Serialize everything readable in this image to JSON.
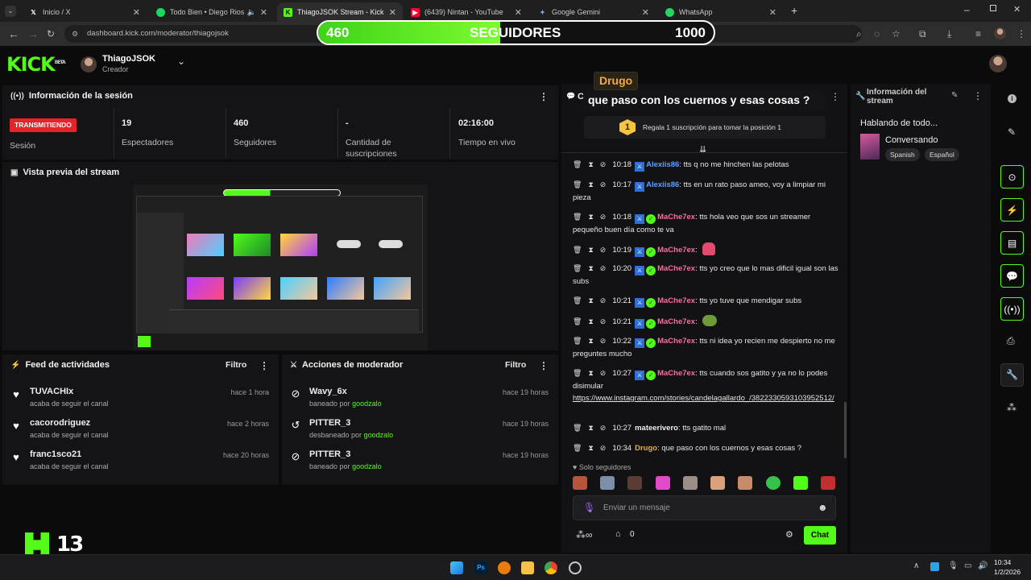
{
  "browser": {
    "tabs": [
      {
        "title": "Inicio / X",
        "icon": "x-logo-icon"
      },
      {
        "title": "Todo Bien • Diego Rios",
        "icon": "spotify-icon"
      },
      {
        "title": "ThiagoJSOK Stream - Kick Dash",
        "icon": "kick-icon"
      },
      {
        "title": "(6439) Nintan - YouTube",
        "icon": "youtube-icon"
      },
      {
        "title": "Google Gemini",
        "icon": "gemini-icon"
      },
      {
        "title": "WhatsApp",
        "icon": "whatsapp-icon"
      }
    ],
    "url": "dashboard.kick.com/moderator/thiagojsok"
  },
  "goal": {
    "current": "460",
    "title": "SEGUIDORES",
    "max": "1000",
    "progress": 0.46
  },
  "header": {
    "logo": "KICK",
    "logo_sup": "BETA",
    "channel": "ThiagoJSOK",
    "role": "Creador"
  },
  "session": {
    "title": "Información de la sesión",
    "live_badge": "TRANSMITIENDO",
    "label": "Sesión",
    "stats": [
      {
        "value": "19",
        "label": "Espectadores"
      },
      {
        "value": "460",
        "label": "Seguidores"
      },
      {
        "value": "-",
        "label": "Cantidad de suscripciones"
      },
      {
        "value": "02:16:00",
        "label": "Tiempo en vivo"
      }
    ]
  },
  "preview": {
    "title": "Vista previa del stream"
  },
  "activity": {
    "title": "Feed de actividades",
    "filter": "Filtro",
    "items": [
      {
        "name": "TUVACHIx",
        "sub": "acaba de seguir el canal",
        "time": "hace 1 hora"
      },
      {
        "name": "cacorodriguez",
        "sub": "acaba de seguir el canal",
        "time": "hace 2 horas"
      },
      {
        "name": "franc1sco21",
        "sub": "acaba de seguir el canal",
        "time": "hace 20 horas"
      }
    ]
  },
  "modactions": {
    "title": "Acciones de moderador",
    "filter": "Filtro",
    "by": "goodzalo",
    "items": [
      {
        "name": "Wavy_6x",
        "sub": "baneado por",
        "time": "hace 19 horas",
        "icon": "ban-icon"
      },
      {
        "name": "PITTER_3",
        "sub": "desbaneado por",
        "time": "hace 19 horas",
        "icon": "undo-icon"
      },
      {
        "name": "PITTER_3",
        "sub": "baneado por",
        "time": "hace 19 horas",
        "icon": "ban-icon"
      }
    ]
  },
  "chat": {
    "title": "Chat",
    "popup_user": "Drugo",
    "popup_text": "que paso con los cuernos y esas cosas ?",
    "gift_rank": "1",
    "gift_text": "Regala 1 suscripción para tomar la posición 1",
    "messages": [
      {
        "time": "10:18",
        "user": "Alexiis86",
        "color": "blue",
        "text": ": tts q no me hinchen las pelotas"
      },
      {
        "time": "10:17",
        "user": "Alexiis86",
        "color": "blue",
        "text": ": tts en un rato paso ameo, voy a limpiar mi pieza"
      },
      {
        "time": "10:18",
        "user": "MaChe7ex",
        "color": "pink",
        "text": ": tts hola veo que sos un streamer pequeño buen día como te va"
      },
      {
        "time": "10:19",
        "user": "MaChe7ex",
        "color": "pink",
        "text": ":"
      },
      {
        "time": "10:20",
        "user": "MaChe7ex",
        "color": "pink",
        "text": ": tts yo creo que lo mas dificil igual son las subs"
      },
      {
        "time": "10:21",
        "user": "MaChe7ex",
        "color": "pink",
        "text": ": tts yo tuve que mendigar subs"
      },
      {
        "time": "10:21",
        "user": "MaChe7ex",
        "color": "pink",
        "text": ":"
      },
      {
        "time": "10:22",
        "user": "MaChe7ex",
        "color": "pink",
        "text": ": tts ni idea yo recien me despierto no me preguntes mucho"
      },
      {
        "time": "10:27",
        "user": "MaChe7ex",
        "color": "pink",
        "text": ": tts cuando sos gatito y ya no lo podes disimular",
        "link": "https://www.instagram.com/stories/candelagallardo_/3822330593103952512/"
      },
      {
        "time": "10:27",
        "user": "mateerivero",
        "color": "white",
        "text": ": tts gatito mal"
      },
      {
        "time": "10:34",
        "user": "Drugo",
        "color": "orange",
        "text": ": que paso con los cuernos y esas cosas ?"
      }
    ],
    "followers_only": "Solo seguidores",
    "input_placeholder": "Enviar un mensaje",
    "points": "0",
    "send": "Chat"
  },
  "stream_info": {
    "title": "Información del stream",
    "stream_title": "Hablando de todo...",
    "category": "Conversando",
    "tags": [
      "Spanish",
      "Español"
    ]
  },
  "overlay_logo": "13",
  "taskbar": {
    "time": "10:34",
    "date": "1/2/2026"
  }
}
